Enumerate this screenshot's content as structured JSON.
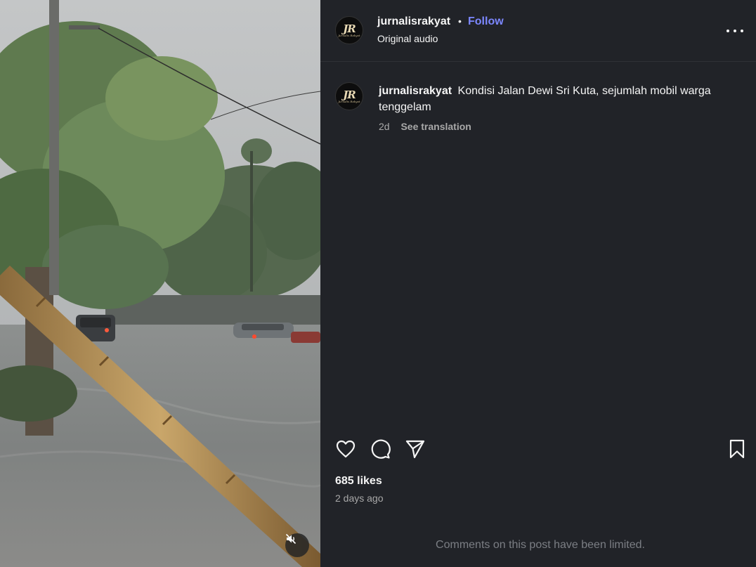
{
  "post": {
    "username": "jurnalisrakyat",
    "follow_label": "Follow",
    "separator": "•",
    "audio_label": "Original audio",
    "avatar": {
      "logo_text": "JR",
      "tagline": "Jurnalis Rakyat"
    },
    "caption": "Kondisi Jalan Dewi Sri Kuta, sejumlah mobil warga tenggelam",
    "caption_age": "2d",
    "see_translation": "See translation",
    "likes": "685 likes",
    "posted_ago": "2 days ago",
    "comments_notice": "Comments on this post have been limited."
  },
  "icons": {
    "more": "more-options-icon",
    "like": "heart-icon",
    "comment": "comment-bubble-icon",
    "share": "send-icon",
    "save": "bookmark-icon",
    "mute": "speaker-muted-icon"
  },
  "colors": {
    "panel_bg": "#212328",
    "follow": "#7c87ff",
    "text_primary": "#f5f5f5",
    "text_secondary": "#a8a8a8",
    "notice": "#7b7e84"
  }
}
